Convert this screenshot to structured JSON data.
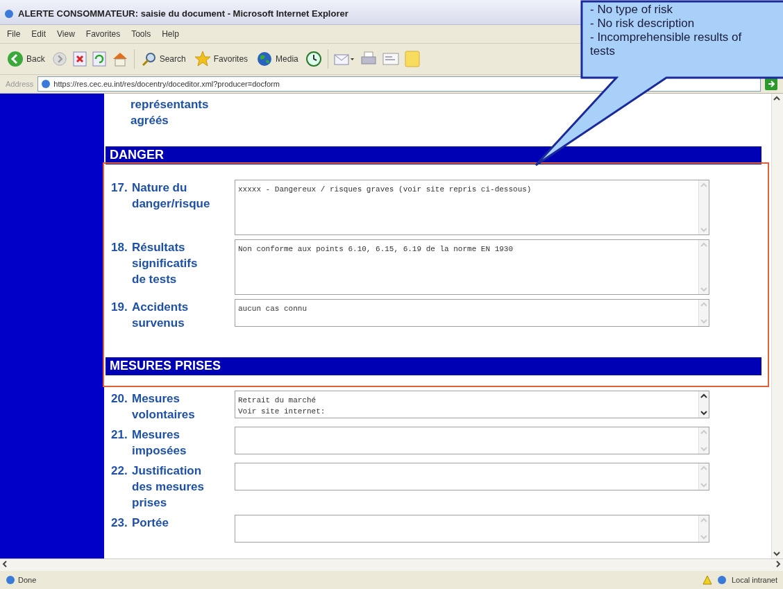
{
  "window": {
    "title": "ALERTE CONSOMMATEUR: saisie du document - Microsoft Internet Explorer"
  },
  "menu": [
    "File",
    "Edit",
    "View",
    "Favorites",
    "Tools",
    "Help"
  ],
  "toolbar": [
    {
      "kind": "back",
      "label": "Back"
    },
    {
      "kind": "forward"
    },
    {
      "kind": "stop"
    },
    {
      "kind": "refresh"
    },
    {
      "kind": "home"
    },
    {
      "kind": "search",
      "label": "Search"
    },
    {
      "kind": "favorites",
      "label": "Favorites"
    },
    {
      "kind": "media",
      "label": "Media"
    },
    {
      "kind": "history"
    },
    {
      "kind": "mail"
    },
    {
      "kind": "print"
    },
    {
      "kind": "edit"
    },
    {
      "kind": "note"
    }
  ],
  "address": {
    "label": "Address",
    "url": "https://res.cec.eu.int/res/docentry/doceditor.xml?producer=docform"
  },
  "form": {
    "leading_label": "représentants agréés",
    "sections": [
      {
        "title": "DANGER",
        "fields": [
          {
            "number": "17.",
            "label": "Nature du danger/risque",
            "kind": "large",
            "scroll_enabled": false,
            "lines": [
              "xxxxx - Dangereux / risques graves (voir site repris ci-dessous)"
            ]
          },
          {
            "number": "18.",
            "label": "Résultats significatifs de tests",
            "kind": "large",
            "scroll_enabled": false,
            "lines": [
              "Non conforme aux points 6.10, 6.15, 6.19 de la norme EN 1930"
            ]
          },
          {
            "number": "19.",
            "label": "Accidents survenus",
            "kind": "small",
            "scroll_enabled": false,
            "lines": [
              "aucun cas connu"
            ]
          }
        ]
      },
      {
        "title": "MESURES PRISES",
        "fields": [
          {
            "number": "20.",
            "label": "Mesures volontaires",
            "kind": "small",
            "scroll_enabled": true,
            "lines": [
              "Retrait du marché",
              "Voir site internet:"
            ]
          },
          {
            "number": "21.",
            "label": "Mesures imposées",
            "kind": "small",
            "scroll_enabled": false
          },
          {
            "number": "22.",
            "label": "Justification des mesures prises",
            "kind": "small",
            "scroll_enabled": false
          },
          {
            "number": "23.",
            "label": "Portée",
            "kind": "small",
            "scroll_enabled": false
          }
        ]
      }
    ]
  },
  "status_bar": {
    "text": "Done",
    "zone": "Local intranet"
  },
  "callout": {
    "lines": [
      "- No type of risk",
      "- No risk description",
      "- Incomprehensible results of tests"
    ]
  }
}
